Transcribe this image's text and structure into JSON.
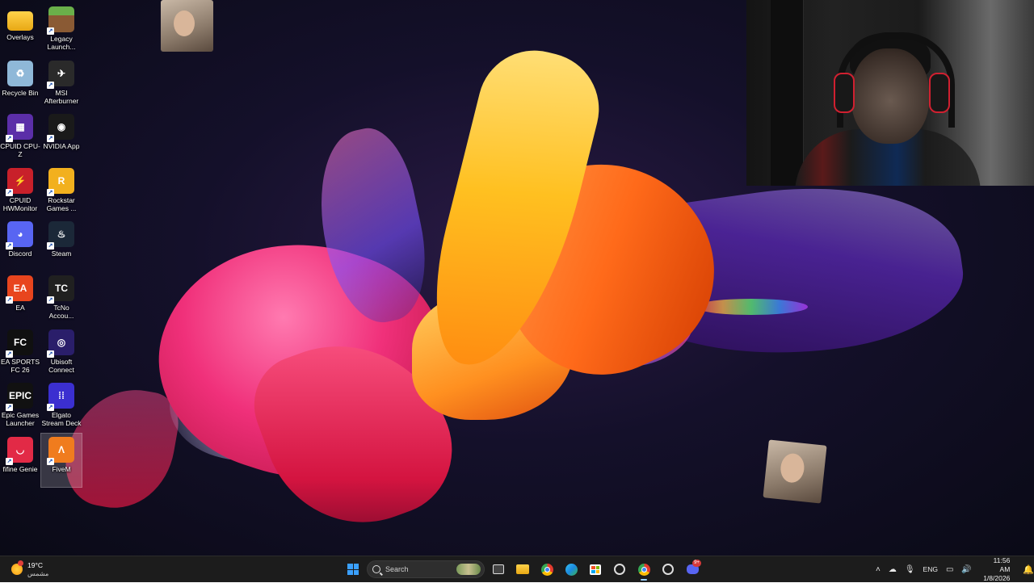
{
  "desktop_icons": [
    {
      "label": "Overlays",
      "icon": "folder-icon",
      "color": "#f2c231",
      "glyph": ""
    },
    {
      "label": "Legacy Launch...",
      "icon": "minecraft-icon",
      "color": "#5a8f3a",
      "glyph": ""
    },
    {
      "label": "Recycle Bin",
      "icon": "recycle-bin-icon",
      "color": "#8fb8d8",
      "glyph": "♻"
    },
    {
      "label": "MSI Afterburner",
      "icon": "msi-afterburner-icon",
      "color": "#2a2a2a",
      "glyph": "✈"
    },
    {
      "label": "CPUID CPU-Z",
      "icon": "cpuz-icon",
      "color": "#5b2ea8",
      "glyph": "▦"
    },
    {
      "label": "NVIDIA App",
      "icon": "nvidia-icon",
      "color": "#1a1a1a",
      "glyph": "◉"
    },
    {
      "label": "CPUID HWMonitor",
      "icon": "hwmonitor-icon",
      "color": "#c8202a",
      "glyph": "⚡"
    },
    {
      "label": "Rockstar Games ...",
      "icon": "rockstar-icon",
      "color": "#f2b01e",
      "glyph": "R"
    },
    {
      "label": "Discord",
      "icon": "discord-icon",
      "color": "#5865f2",
      "glyph": "◕"
    },
    {
      "label": "Steam",
      "icon": "steam-icon",
      "color": "#1b2838",
      "glyph": "♨"
    },
    {
      "label": "EA",
      "icon": "ea-icon",
      "color": "#e8451e",
      "glyph": "EA"
    },
    {
      "label": "TcNo Accou...",
      "icon": "tcno-icon",
      "color": "#202020",
      "glyph": "TC"
    },
    {
      "label": "EA SPORTS FC 26",
      "icon": "ea-fc26-icon",
      "color": "#101010",
      "glyph": "FC"
    },
    {
      "label": "Ubisoft Connect",
      "icon": "ubisoft-icon",
      "color": "#2a1e6a",
      "glyph": "◎"
    },
    {
      "label": "Epic Games Launcher",
      "icon": "epic-games-icon",
      "color": "#111111",
      "glyph": "EPIC"
    },
    {
      "label": "Elgato Stream Deck",
      "icon": "stream-deck-icon",
      "color": "#3b2fd0",
      "glyph": "⁞⁞"
    },
    {
      "label": "fifine Genie",
      "icon": "fifine-icon",
      "color": "#e22a46",
      "glyph": "◡"
    },
    {
      "label": "FiveM",
      "icon": "fivem-icon",
      "color": "#f07c1e",
      "glyph": "Λ"
    }
  ],
  "taskbar": {
    "weather_temp": "19°C",
    "weather_desc": "مشمس",
    "search_placeholder": "Search",
    "discord_badge": "9+",
    "language": "ENG",
    "time": "11:56 AM",
    "date": "1/8/2026"
  },
  "colors": {
    "taskbar_bg": "#1c1c1c",
    "accent": "#3aa0ff"
  }
}
